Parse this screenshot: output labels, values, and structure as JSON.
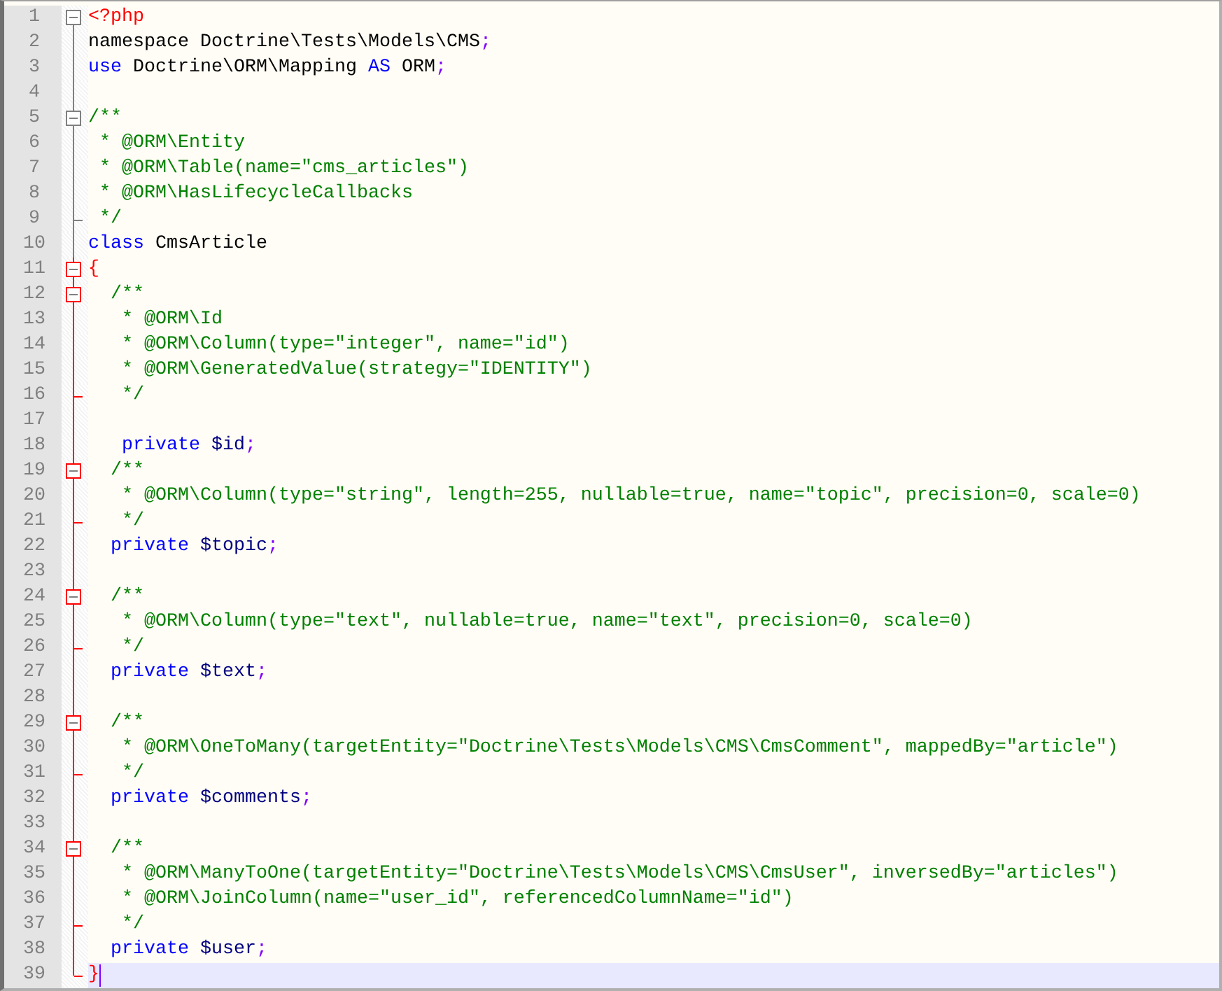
{
  "editor": {
    "lines": [
      {
        "number": "1",
        "kind": "box",
        "in_block": false,
        "current": false,
        "tokens": [
          {
            "kind": "php-tag",
            "text": "<?php"
          }
        ]
      },
      {
        "number": "2",
        "kind": "line",
        "in_block": false,
        "current": false,
        "tokens": [
          {
            "kind": "plain",
            "text": "namespace Doctrine\\Tests\\Models\\CMS"
          },
          {
            "kind": "operator",
            "text": ";"
          }
        ]
      },
      {
        "number": "3",
        "kind": "line",
        "in_block": false,
        "current": false,
        "tokens": [
          {
            "kind": "keyword",
            "text": "use"
          },
          {
            "kind": "plain",
            "text": " Doctrine\\ORM\\Mapping "
          },
          {
            "kind": "keyword",
            "text": "AS"
          },
          {
            "kind": "plain",
            "text": " ORM"
          },
          {
            "kind": "operator",
            "text": ";"
          }
        ]
      },
      {
        "number": "4",
        "kind": "line",
        "in_block": false,
        "current": false
      },
      {
        "number": "5",
        "kind": "box",
        "in_block": false,
        "current": false,
        "tokens": [
          {
            "kind": "comment",
            "text": "/**"
          }
        ]
      },
      {
        "number": "6",
        "kind": "line",
        "in_block": false,
        "current": false,
        "tokens": [
          {
            "kind": "comment",
            "text": " * @ORM\\Entity"
          }
        ]
      },
      {
        "number": "7",
        "kind": "line",
        "in_block": false,
        "current": false,
        "tokens": [
          {
            "kind": "comment",
            "text": " * @ORM\\Table(name=\"cms_articles\")"
          }
        ]
      },
      {
        "number": "8",
        "kind": "line",
        "in_block": false,
        "current": false,
        "tokens": [
          {
            "kind": "comment",
            "text": " * @ORM\\HasLifecycleCallbacks"
          }
        ]
      },
      {
        "number": "9",
        "kind": "tick",
        "in_block": false,
        "current": false,
        "tokens": [
          {
            "kind": "comment",
            "text": " */"
          }
        ]
      },
      {
        "number": "10",
        "kind": "line",
        "in_block": false,
        "current": false,
        "tokens": [
          {
            "kind": "keyword",
            "text": "class"
          },
          {
            "kind": "plain",
            "text": " CmsArticle"
          }
        ]
      },
      {
        "number": "11",
        "kind": "box",
        "in_block": true,
        "current": false,
        "tokens": [
          {
            "kind": "php-tag",
            "text": "{"
          }
        ]
      },
      {
        "number": "12",
        "kind": "box",
        "in_block": true,
        "current": false,
        "tokens": [
          {
            "kind": "comment",
            "text": "  /**"
          }
        ]
      },
      {
        "number": "13",
        "kind": "line",
        "in_block": true,
        "current": false,
        "tokens": [
          {
            "kind": "comment",
            "text": "   * @ORM\\Id"
          }
        ]
      },
      {
        "number": "14",
        "kind": "line",
        "in_block": true,
        "current": false,
        "tokens": [
          {
            "kind": "comment",
            "text": "   * @ORM\\Column(type=\"integer\", name=\"id\")"
          }
        ]
      },
      {
        "number": "15",
        "kind": "line",
        "in_block": true,
        "current": false,
        "tokens": [
          {
            "kind": "comment",
            "text": "   * @ORM\\GeneratedValue(strategy=\"IDENTITY\")"
          }
        ]
      },
      {
        "number": "16",
        "kind": "tick",
        "in_block": true,
        "current": false,
        "tokens": [
          {
            "kind": "comment",
            "text": "   */"
          }
        ]
      },
      {
        "number": "17",
        "kind": "line",
        "in_block": true,
        "current": false
      },
      {
        "number": "18",
        "kind": "line",
        "in_block": true,
        "current": false,
        "tokens": [
          {
            "kind": "keyword",
            "text": "   private"
          },
          {
            "kind": "variable",
            "text": " $id"
          },
          {
            "kind": "operator",
            "text": ";"
          }
        ]
      },
      {
        "number": "19",
        "kind": "box",
        "in_block": true,
        "current": false,
        "tokens": [
          {
            "kind": "comment",
            "text": "  /**"
          }
        ]
      },
      {
        "number": "20",
        "kind": "line",
        "in_block": true,
        "current": false,
        "tokens": [
          {
            "kind": "comment",
            "text": "   * @ORM\\Column(type=\"string\", length=255, nullable=true, name=\"topic\", precision=0, scale=0)"
          }
        ]
      },
      {
        "number": "21",
        "kind": "tick",
        "in_block": true,
        "current": false,
        "tokens": [
          {
            "kind": "comment",
            "text": "   */"
          }
        ]
      },
      {
        "number": "22",
        "kind": "line",
        "in_block": true,
        "current": false,
        "tokens": [
          {
            "kind": "keyword",
            "text": "  private"
          },
          {
            "kind": "variable",
            "text": " $topic"
          },
          {
            "kind": "operator",
            "text": ";"
          }
        ]
      },
      {
        "number": "23",
        "kind": "line",
        "in_block": true,
        "current": false
      },
      {
        "number": "24",
        "kind": "box",
        "in_block": true,
        "current": false,
        "tokens": [
          {
            "kind": "comment",
            "text": "  /**"
          }
        ]
      },
      {
        "number": "25",
        "kind": "line",
        "in_block": true,
        "current": false,
        "tokens": [
          {
            "kind": "comment",
            "text": "   * @ORM\\Column(type=\"text\", nullable=true, name=\"text\", precision=0, scale=0)"
          }
        ]
      },
      {
        "number": "26",
        "kind": "tick",
        "in_block": true,
        "current": false,
        "tokens": [
          {
            "kind": "comment",
            "text": "   */"
          }
        ]
      },
      {
        "number": "27",
        "kind": "line",
        "in_block": true,
        "current": false,
        "tokens": [
          {
            "kind": "keyword",
            "text": "  private"
          },
          {
            "kind": "variable",
            "text": " $text"
          },
          {
            "kind": "operator",
            "text": ";"
          }
        ]
      },
      {
        "number": "28",
        "kind": "line",
        "in_block": true,
        "current": false
      },
      {
        "number": "29",
        "kind": "box",
        "in_block": true,
        "current": false,
        "tokens": [
          {
            "kind": "comment",
            "text": "  /**"
          }
        ]
      },
      {
        "number": "30",
        "kind": "line",
        "in_block": true,
        "current": false,
        "tokens": [
          {
            "kind": "comment",
            "text": "   * @ORM\\OneToMany(targetEntity=\"Doctrine\\Tests\\Models\\CMS\\CmsComment\", mappedBy=\"article\")"
          }
        ]
      },
      {
        "number": "31",
        "kind": "tick",
        "in_block": true,
        "current": false,
        "tokens": [
          {
            "kind": "comment",
            "text": "   */"
          }
        ]
      },
      {
        "number": "32",
        "kind": "line",
        "in_block": true,
        "current": false,
        "tokens": [
          {
            "kind": "keyword",
            "text": "  private"
          },
          {
            "kind": "variable",
            "text": " $comments"
          },
          {
            "kind": "operator",
            "text": ";"
          }
        ]
      },
      {
        "number": "33",
        "kind": "line",
        "in_block": true,
        "current": false
      },
      {
        "number": "34",
        "kind": "box",
        "in_block": true,
        "current": false,
        "tokens": [
          {
            "kind": "comment",
            "text": "  /**"
          }
        ]
      },
      {
        "number": "35",
        "kind": "line",
        "in_block": true,
        "current": false,
        "tokens": [
          {
            "kind": "comment",
            "text": "   * @ORM\\ManyToOne(targetEntity=\"Doctrine\\Tests\\Models\\CMS\\CmsUser\", inversedBy=\"articles\")"
          }
        ]
      },
      {
        "number": "36",
        "kind": "line",
        "in_block": true,
        "current": false,
        "tokens": [
          {
            "kind": "comment",
            "text": "   * @ORM\\JoinColumn(name=\"user_id\", referencedColumnName=\"id\")"
          }
        ]
      },
      {
        "number": "37",
        "kind": "tick",
        "in_block": true,
        "current": false,
        "tokens": [
          {
            "kind": "comment",
            "text": "   */"
          }
        ]
      },
      {
        "number": "38",
        "kind": "line",
        "in_block": true,
        "current": false,
        "tokens": [
          {
            "kind": "keyword",
            "text": "  private"
          },
          {
            "kind": "variable",
            "text": " $user"
          },
          {
            "kind": "operator",
            "text": ";"
          }
        ]
      },
      {
        "number": "39",
        "kind": "end",
        "in_block": true,
        "current": true,
        "tokens": [
          {
            "kind": "php-tag",
            "text": "}"
          }
        ]
      }
    ]
  }
}
